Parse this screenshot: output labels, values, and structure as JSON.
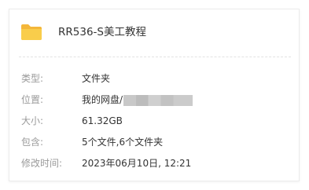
{
  "folder": {
    "icon": "folder-icon",
    "icon_color": "#F9CD4B",
    "name": "RR536-S美工教程"
  },
  "properties": {
    "type": {
      "label": "类型:",
      "value": "文件夹"
    },
    "location": {
      "label": "位置:",
      "value": "我的网盘/"
    },
    "size": {
      "label": "大小:",
      "value": "61.32GB"
    },
    "contains": {
      "label": "包含:",
      "value": "5个文件,6个文件夹"
    },
    "modified": {
      "label": "修改时间:",
      "value": "2023年06月10日, 12:21"
    }
  }
}
